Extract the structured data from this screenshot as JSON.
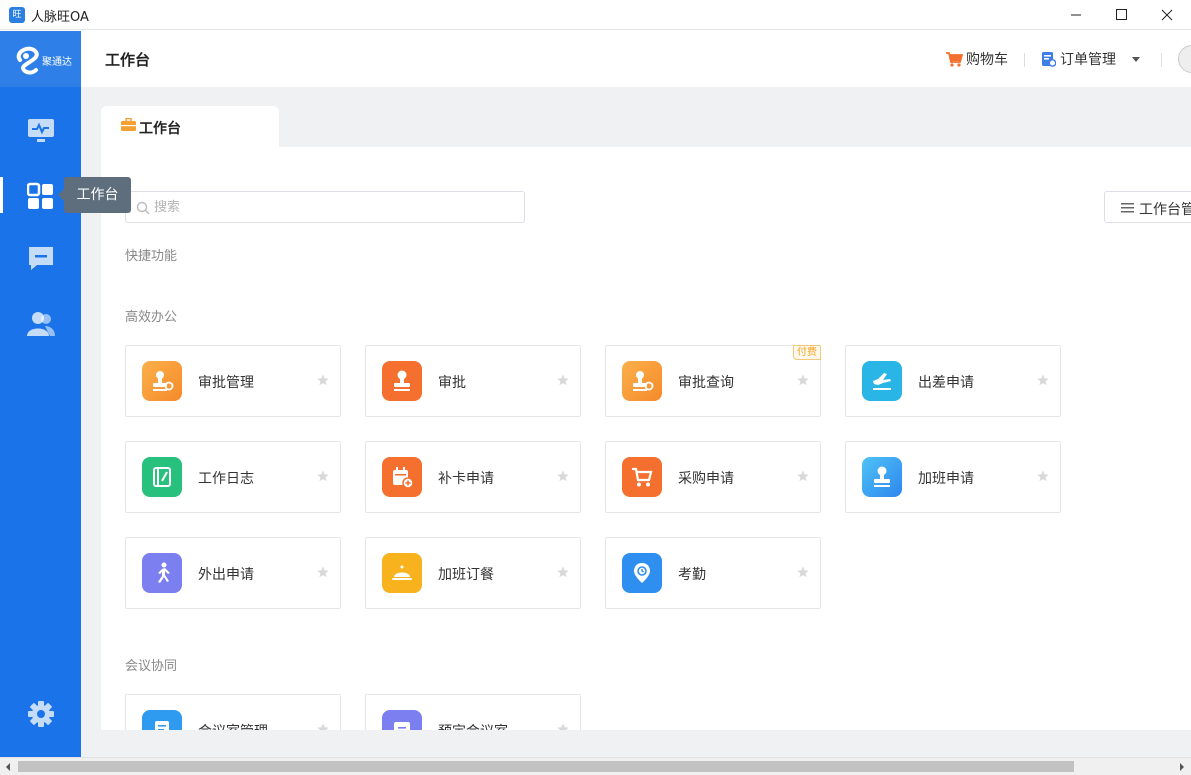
{
  "window": {
    "app_icon_text": "旺",
    "title": "人脉旺OA"
  },
  "sidebar": {
    "logo_text": "聚通达",
    "items": [
      {
        "name": "monitor-icon"
      },
      {
        "name": "apps-grid-icon",
        "active": true,
        "tooltip": "工作台"
      },
      {
        "name": "message-icon"
      },
      {
        "name": "contacts-icon"
      }
    ],
    "settings_icon": "gear-icon"
  },
  "header": {
    "title": "工作台",
    "cart_label": "购物车",
    "order_label": "订单管理"
  },
  "tab": {
    "label": "工作台"
  },
  "search": {
    "placeholder": "搜索",
    "value": ""
  },
  "manage_button": {
    "label": "工作台管"
  },
  "sections": {
    "quick": "快捷功能",
    "office": "高效办公",
    "meeting": "会议协同"
  },
  "office_cards": [
    {
      "label": "审批管理",
      "icon": "stamp-gear-icon",
      "color": "#f89a3a"
    },
    {
      "label": "审批",
      "icon": "stamp-icon",
      "color": "#f5702f"
    },
    {
      "label": "审批查询",
      "icon": "stamp-search-icon",
      "color": "#f89a3a",
      "badge": "付费"
    },
    {
      "label": "出差申请",
      "icon": "plane-icon",
      "color": "#29b6e6"
    },
    {
      "label": "工作日志",
      "icon": "journal-icon",
      "color": "#27c07d"
    },
    {
      "label": "补卡申请",
      "icon": "calendar-add-icon",
      "color": "#f5702f"
    },
    {
      "label": "采购申请",
      "icon": "cart-icon",
      "color": "#f5702f"
    },
    {
      "label": "加班申请",
      "icon": "stamp-blue-icon",
      "color": "#2e9af0"
    },
    {
      "label": "外出申请",
      "icon": "walk-icon",
      "color": "#7b7ff0"
    },
    {
      "label": "加班订餐",
      "icon": "cloche-icon",
      "color": "#f7b21d"
    },
    {
      "label": "考勤",
      "icon": "location-clock-icon",
      "color": "#2e8ff0"
    }
  ],
  "meeting_cards": [
    {
      "label": "会议室管理",
      "icon": "meeting-room-icon",
      "color": "#2e9af0"
    },
    {
      "label": "预定会议室",
      "icon": "booking-icon",
      "color": "#7b7ff0"
    }
  ]
}
